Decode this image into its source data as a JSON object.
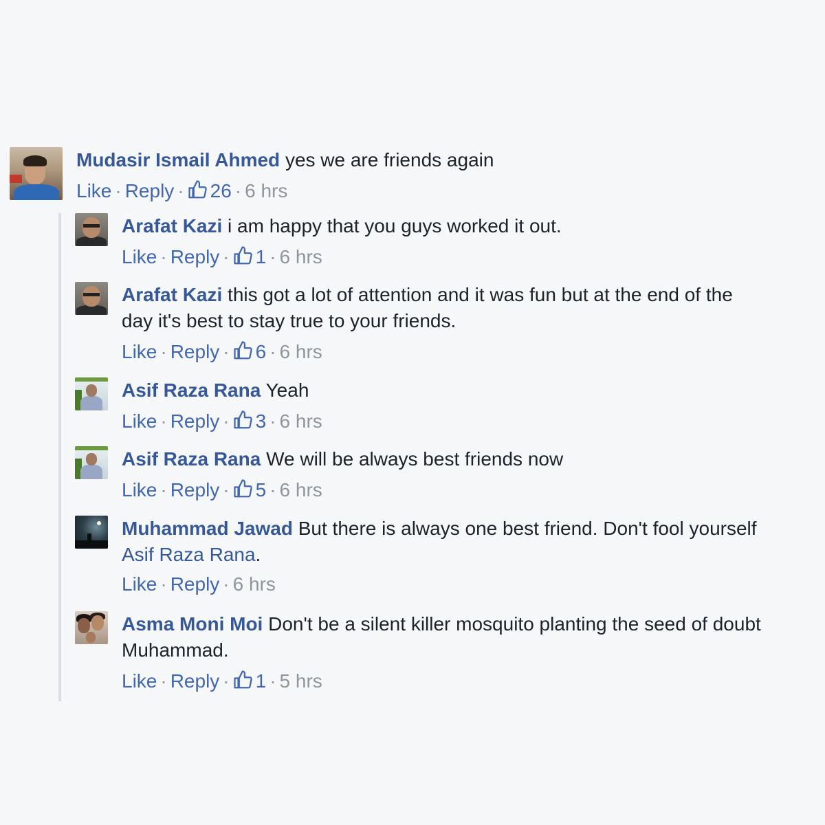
{
  "labels": {
    "like": "Like",
    "reply": "Reply",
    "separator": "·"
  },
  "colors": {
    "author": "#365899",
    "link": "#4267b2",
    "meta": "#90949c",
    "background": "#f6f7f9"
  },
  "comments": [
    {
      "author": "Mudasir Ismail Ahmed",
      "text": "yes we are friends again",
      "likes": "26",
      "time": "6 hrs",
      "avatar_icon": "profile-photo"
    }
  ],
  "replies": [
    {
      "author": "Arafat Kazi",
      "text": "i am happy that you guys worked it out.",
      "likes": "1",
      "time": "6 hrs"
    },
    {
      "author": "Arafat Kazi",
      "text": "this got a lot of attention and it was fun but at the end of the day it's best to stay true to your friends.",
      "likes": "6",
      "time": "6 hrs"
    },
    {
      "author": "Asif Raza Rana",
      "text": "Yeah",
      "likes": "3",
      "time": "6 hrs"
    },
    {
      "author": "Asif Raza Rana",
      "text": "We will be always best friends now",
      "likes": "5",
      "time": "6 hrs"
    },
    {
      "author": "Muhammad Jawad",
      "text": "But there is always one best friend. Don't fool yourself",
      "mention": "Asif Raza Rana",
      "text_after": ".",
      "time": "6 hrs"
    },
    {
      "author": "Asma Moni Moi",
      "text": "Don't be a silent killer mosquito planting the seed of doubt Muhammad.",
      "likes": "1",
      "time": "5 hrs"
    }
  ]
}
